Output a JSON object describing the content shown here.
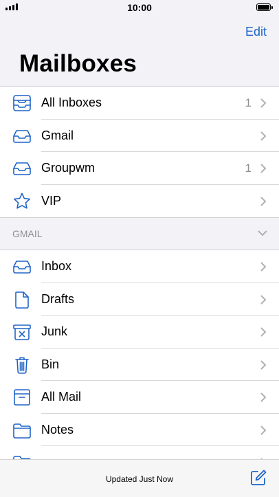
{
  "status": {
    "time": "10:00"
  },
  "header": {
    "edit_label": "Edit",
    "title": "Mailboxes"
  },
  "mailboxes": [
    {
      "icon": "all-inboxes-icon",
      "label": "All Inboxes",
      "count": "1"
    },
    {
      "icon": "inbox-tray-icon",
      "label": "Gmail",
      "count": ""
    },
    {
      "icon": "inbox-tray-icon",
      "label": "Groupwm",
      "count": "1"
    },
    {
      "icon": "star-icon",
      "label": "VIP",
      "count": ""
    }
  ],
  "section": {
    "label": "GMAIL"
  },
  "gmail_folders": [
    {
      "icon": "inbox-tray-icon",
      "label": "Inbox"
    },
    {
      "icon": "document-icon",
      "label": "Drafts"
    },
    {
      "icon": "junk-bin-icon",
      "label": "Junk"
    },
    {
      "icon": "trash-icon",
      "label": "Bin"
    },
    {
      "icon": "archive-box-icon",
      "label": "All Mail"
    },
    {
      "icon": "folder-icon",
      "label": "Notes"
    },
    {
      "icon": "folder-icon",
      "label": ""
    }
  ],
  "toolbar": {
    "status_text": "Updated Just Now",
    "compose_icon": "compose-icon"
  },
  "colors": {
    "accent": "#1f64c8",
    "secondary": "#8e8e93",
    "background": "#f2f2f7"
  }
}
